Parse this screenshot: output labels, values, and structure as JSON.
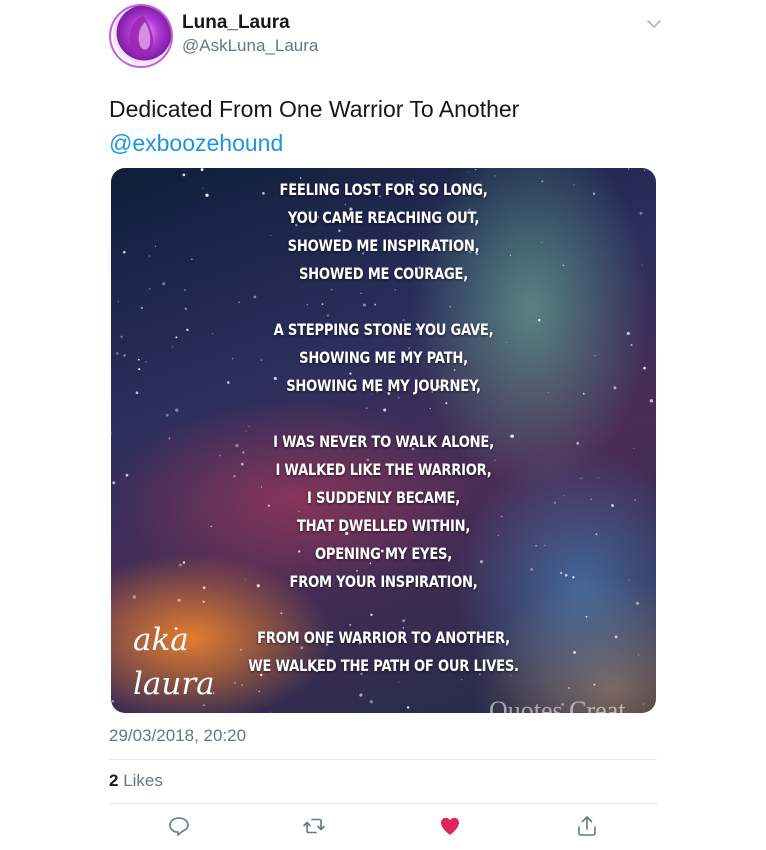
{
  "user": {
    "display_name": "Luna_Laura",
    "handle": "@AskLuna_Laura",
    "avatar_icon": "purple-angel-wing-avatar"
  },
  "tweet": {
    "text": "Dedicated From One Warrior To Another",
    "mention": "@exboozehound",
    "timestamp": "29/03/2018, 20:20",
    "likes_count": "2",
    "likes_label": "Likes"
  },
  "image": {
    "poem_lines": [
      "FEELING LOST FOR SO LONG,",
      "YOU CAME REACHING OUT,",
      "SHOWED ME INSPIRATION,",
      "SHOWED ME COURAGE,",
      "",
      "A STEPPING STONE YOU GAVE,",
      "SHOWING ME MY PATH,",
      "SHOWING ME MY JOURNEY,",
      "",
      "I WAS NEVER TO WALK ALONE,",
      "I WALKED LIKE THE WARRIOR,",
      "I SUDDENLY BECAME,",
      "THAT DWELLED WITHIN,",
      "OPENING MY EYES,",
      "FROM YOUR INSPIRATION,",
      "",
      "FROM ONE WARRIOR TO ANOTHER,",
      "WE WALKED THE PATH OF OUR LIVES."
    ],
    "signature_line1": "aka",
    "signature_line2": "laura",
    "watermark": "Quotes Creat"
  },
  "actions": {
    "reply_icon": "reply-icon",
    "retweet_icon": "retweet-icon",
    "like_icon": "heart-icon",
    "share_icon": "share-icon",
    "like_color": "#e0245e",
    "icon_color": "#657786",
    "link_color": "#1b95e0"
  }
}
